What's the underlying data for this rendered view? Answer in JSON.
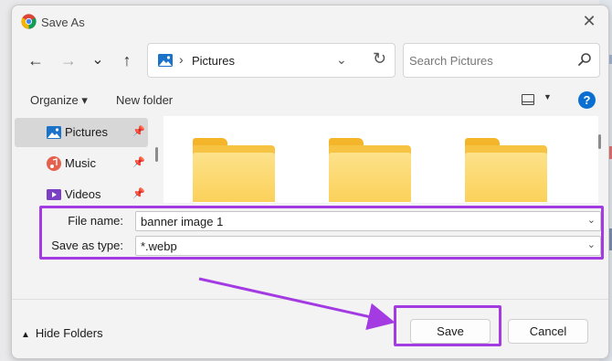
{
  "window": {
    "title": "Save As"
  },
  "nav": {
    "back": "←",
    "forward": "→",
    "recent": "⌄",
    "up": "↑"
  },
  "address": {
    "separator": "›",
    "path": "Pictures"
  },
  "search": {
    "placeholder": "Search Pictures"
  },
  "toolbar": {
    "organize": "Organize ▾",
    "new_folder": "New folder"
  },
  "sidebar": {
    "items": [
      {
        "label": "Pictures",
        "icon": "pictures-icon",
        "selected": true
      },
      {
        "label": "Music",
        "icon": "music-icon"
      },
      {
        "label": "Videos",
        "icon": "videos-icon"
      }
    ]
  },
  "form": {
    "file_name_label": "File name:",
    "file_name_value": "banner image 1",
    "save_type_label": "Save as type:",
    "save_type_value": "*.webp"
  },
  "footer": {
    "hide_folders": "Hide Folders",
    "save": "Save",
    "cancel": "Cancel"
  },
  "colors": {
    "highlight": "#a43be2",
    "accent": "#0a6fd1",
    "folder": "#f6c343"
  }
}
